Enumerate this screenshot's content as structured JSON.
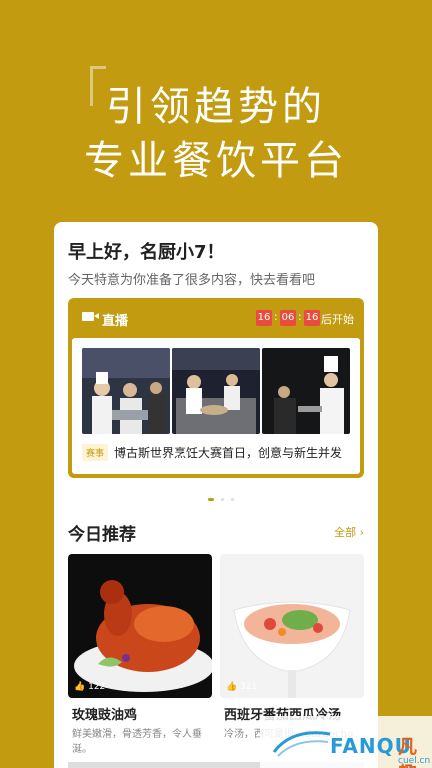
{
  "hero": {
    "line1": "引领趋势的",
    "line2": "专业餐饮平台"
  },
  "card": {
    "greeting": "早上好，名厨小7！",
    "subtitle": "今天特意为你准备了很多内容，快去看看吧"
  },
  "live": {
    "icon": "video-camera-icon",
    "title": "直播",
    "countdown": {
      "h": "16",
      "m": "06",
      "s": "16"
    },
    "countdown_suffix": "后开始",
    "tag": "赛事",
    "headline": "博古斯世界烹饪大赛首日，创意与新生并发"
  },
  "recommend": {
    "title": "今日推荐",
    "all_label": "全部",
    "items": [
      {
        "name": "玫瑰豉油鸡",
        "desc": "鲜美嫩滑，骨透芳香，令人垂涎。",
        "likes": "122"
      },
      {
        "name": "西班牙番茄西瓜冷汤",
        "desc": "冷汤，西可是很...Gazpacho",
        "likes": "321"
      }
    ]
  },
  "watermark": {
    "brand": "FANQU",
    "brand_cn": "凡趣",
    "domain": "cuel.cn"
  },
  "colors": {
    "accent": "#c39b10",
    "countdown_bg": "#e94b3c"
  }
}
